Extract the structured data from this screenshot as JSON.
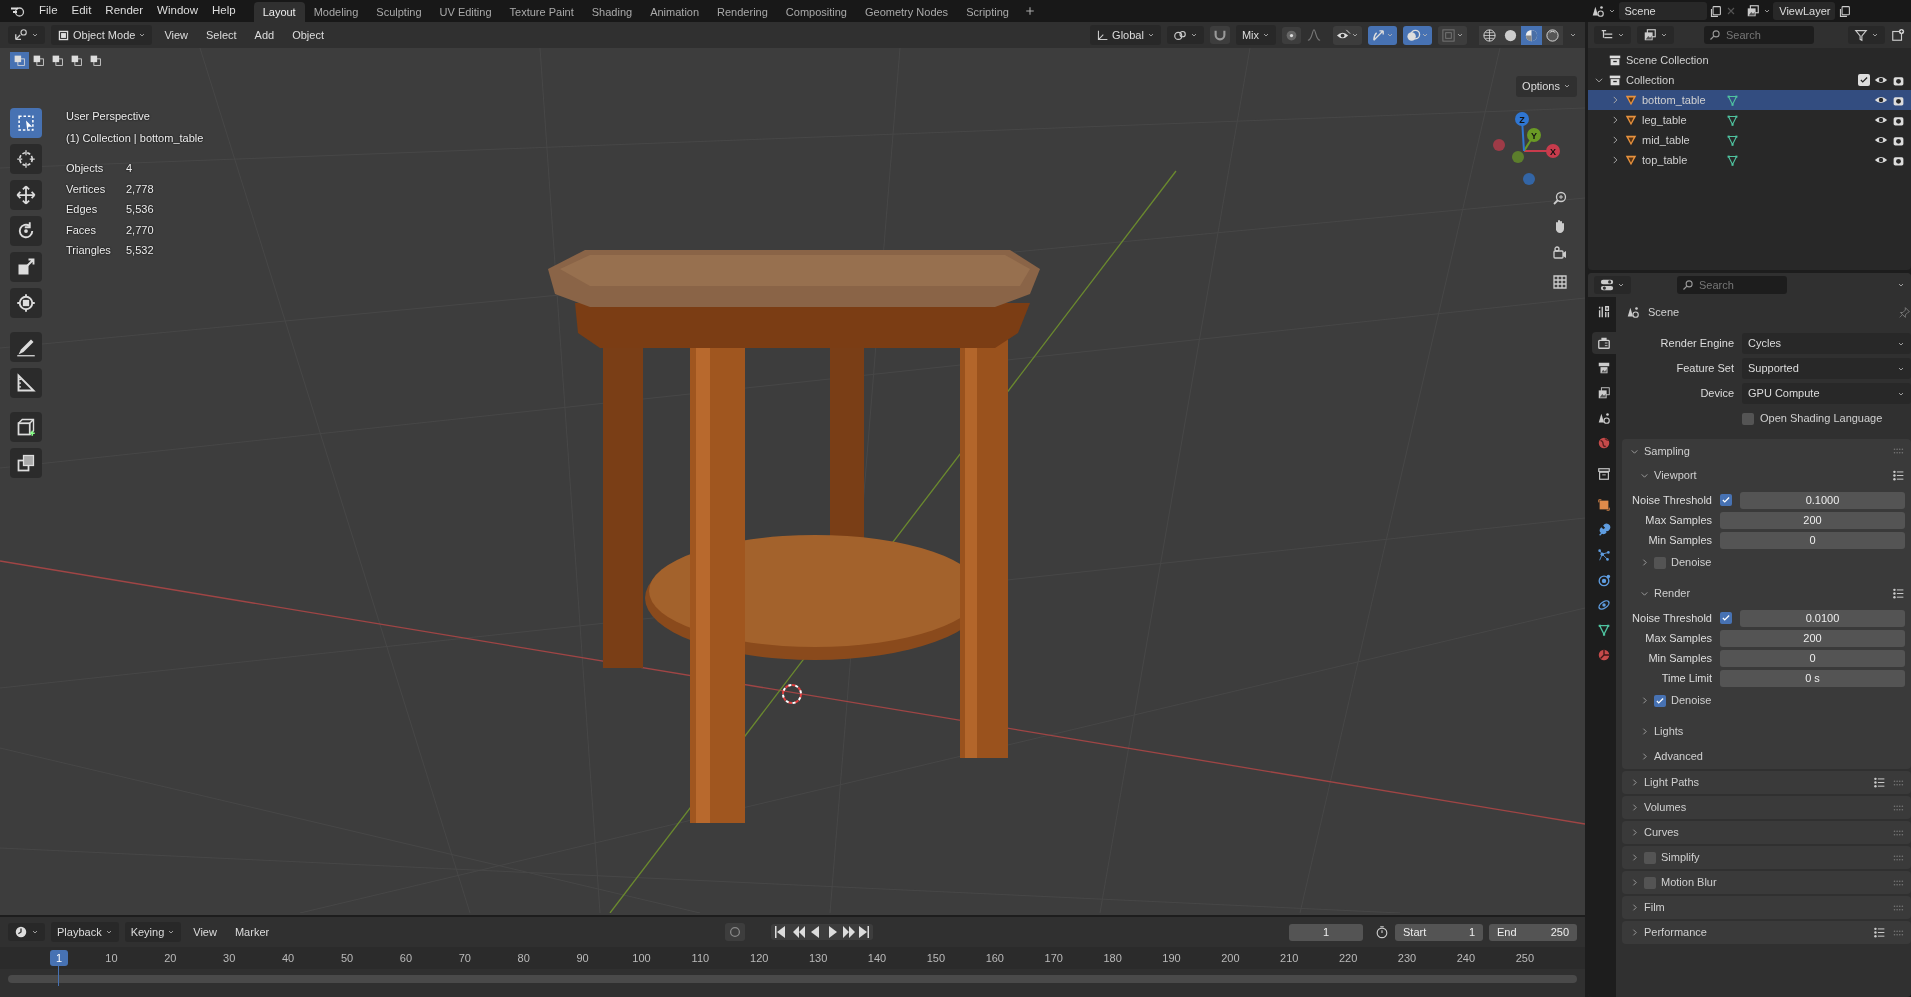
{
  "menu": [
    "File",
    "Edit",
    "Render",
    "Window",
    "Help"
  ],
  "workspaces": [
    {
      "label": "Layout",
      "selected": true
    },
    {
      "label": "Modeling",
      "selected": false
    },
    {
      "label": "Sculpting",
      "selected": false
    },
    {
      "label": "UV Editing",
      "selected": false
    },
    {
      "label": "Texture Paint",
      "selected": false
    },
    {
      "label": "Shading",
      "selected": false
    },
    {
      "label": "Animation",
      "selected": false
    },
    {
      "label": "Rendering",
      "selected": false
    },
    {
      "label": "Compositing",
      "selected": false
    },
    {
      "label": "Geometry Nodes",
      "selected": false
    },
    {
      "label": "Scripting",
      "selected": false
    }
  ],
  "scene": "Scene",
  "view_layer": "ViewLayer",
  "viewport": {
    "mode": "Object Mode",
    "editor_menus": [
      "View",
      "Select",
      "Add",
      "Object"
    ],
    "orientation": "Global",
    "snap_target": "Mix",
    "toggles": [
      {
        "kind": "visibility",
        "on": false
      },
      {
        "kind": "gizmo",
        "on": true
      },
      {
        "kind": "overlay",
        "on": true
      },
      {
        "kind": "xray",
        "on": false
      }
    ],
    "shading": [
      {
        "kind": "wireframe",
        "selected": false
      },
      {
        "kind": "solid",
        "selected": false
      },
      {
        "kind": "material",
        "selected": true
      },
      {
        "kind": "rendered",
        "selected": false
      }
    ],
    "select_modes": [
      {
        "selected": true
      },
      {
        "selected": false
      },
      {
        "selected": false
      },
      {
        "selected": false
      },
      {
        "selected": false
      }
    ],
    "options": "Options",
    "view_name": "User Perspective",
    "context": "(1) Collection | bottom_table",
    "stats": [
      {
        "label": "Objects",
        "value": "4"
      },
      {
        "label": "Vertices",
        "value": "2,778"
      },
      {
        "label": "Edges",
        "value": "5,536"
      },
      {
        "label": "Faces",
        "value": "2,770"
      },
      {
        "label": "Triangles",
        "value": "5,532"
      }
    ],
    "tools": [
      {
        "kind": "select",
        "selected": true
      },
      {
        "kind": "cursor",
        "selected": false
      },
      {
        "kind": "move",
        "selected": false
      },
      {
        "kind": "rotate",
        "selected": false
      },
      {
        "kind": "scale",
        "selected": false
      },
      {
        "kind": "transform",
        "selected": false
      },
      {
        "kind": "annotate",
        "selected": false
      },
      {
        "kind": "measure",
        "selected": false
      },
      {
        "kind": "add_cube",
        "selected": false
      },
      {
        "kind": "extrude",
        "selected": false
      }
    ],
    "gizmo_axes": [
      "X",
      "Y",
      "Z"
    ]
  },
  "outliner": {
    "search_placeholder": "Search",
    "root": "Scene Collection",
    "collection": {
      "label": "Collection",
      "expanded": true,
      "checked": true,
      "children": [
        {
          "label": "bottom_table",
          "selected": true,
          "expanded": false
        },
        {
          "label": "leg_table",
          "selected": false,
          "expanded": false
        },
        {
          "label": "mid_table",
          "selected": false,
          "expanded": false
        },
        {
          "label": "top_table",
          "selected": false,
          "expanded": false
        }
      ]
    }
  },
  "properties": {
    "search_placeholder": "Search",
    "context": "Scene",
    "tabs": [
      {
        "kind": "tool",
        "selected": false
      },
      {
        "kind": "render",
        "selected": true
      },
      {
        "kind": "output",
        "selected": false
      },
      {
        "kind": "view_layer",
        "selected": false
      },
      {
        "kind": "scene",
        "selected": false
      },
      {
        "kind": "world",
        "selected": false
      },
      {
        "kind": "collection",
        "selected": false
      },
      {
        "kind": "object",
        "selected": false
      },
      {
        "kind": "modifiers",
        "selected": false
      },
      {
        "kind": "particles",
        "selected": false
      },
      {
        "kind": "physics",
        "selected": false
      },
      {
        "kind": "constraints",
        "selected": false
      },
      {
        "kind": "data",
        "selected": false
      },
      {
        "kind": "material",
        "selected": false
      }
    ],
    "fields": [
      {
        "kind": "dropdown",
        "label": "Render Engine",
        "value": "Cycles"
      },
      {
        "kind": "dropdown",
        "label": "Feature Set",
        "value": "Supported"
      },
      {
        "kind": "dropdown",
        "label": "Device",
        "value": "GPU Compute"
      },
      {
        "kind": "checkbox",
        "label": "Open Shading Language",
        "checked": false
      }
    ],
    "panels": [
      {
        "title": "Sampling",
        "expanded": true,
        "presets": false,
        "children": [
          {
            "kind": "subpanel",
            "title": "Viewport",
            "expanded": true,
            "presets": true,
            "children": [
              {
                "kind": "number",
                "label": "Noise Threshold",
                "checked": true,
                "value": "0.1000"
              },
              {
                "kind": "number",
                "label": "Max Samples",
                "value": "200"
              },
              {
                "kind": "number",
                "label": "Min Samples",
                "value": "0"
              },
              {
                "kind": "subpanel",
                "title": "Denoise",
                "expanded": false,
                "presets": false,
                "checked": false
              }
            ]
          },
          {
            "kind": "subpanel",
            "title": "Render",
            "expanded": true,
            "presets": true,
            "children": [
              {
                "kind": "number",
                "label": "Noise Threshold",
                "checked": true,
                "value": "0.0100"
              },
              {
                "kind": "number",
                "label": "Max Samples",
                "value": "200"
              },
              {
                "kind": "number",
                "label": "Min Samples",
                "value": "0"
              },
              {
                "kind": "number",
                "label": "Time Limit",
                "value": "0 s"
              },
              {
                "kind": "subpanel",
                "title": "Denoise",
                "expanded": false,
                "presets": false,
                "checked": true
              }
            ]
          },
          {
            "kind": "subpanel",
            "title": "Lights",
            "expanded": false,
            "presets": false
          },
          {
            "kind": "subpanel",
            "title": "Advanced",
            "expanded": false,
            "presets": false
          }
        ]
      },
      {
        "title": "Light Paths",
        "expanded": false,
        "presets": true
      },
      {
        "title": "Volumes",
        "expanded": false,
        "presets": false
      },
      {
        "title": "Curves",
        "expanded": false,
        "presets": false
      },
      {
        "title": "Simplify",
        "expanded": false,
        "presets": false,
        "checked": false
      },
      {
        "title": "Motion Blur",
        "expanded": false,
        "presets": false,
        "checked": false
      },
      {
        "title": "Film",
        "expanded": false,
        "presets": false
      },
      {
        "title": "Performance",
        "expanded": false,
        "presets": true
      }
    ]
  },
  "timeline": {
    "menus": [
      "Playback",
      "Keying",
      "View",
      "Marker"
    ],
    "current_frame": "1",
    "start_label": "Start",
    "start": "1",
    "end_label": "End",
    "end": "250",
    "ruler_current": "1",
    "ruler": [
      "10",
      "20",
      "30",
      "40",
      "50",
      "60",
      "70",
      "80",
      "90",
      "100",
      "110",
      "120",
      "130",
      "140",
      "150",
      "160",
      "170",
      "180",
      "190",
      "200",
      "210",
      "220",
      "230",
      "240",
      "250"
    ]
  }
}
